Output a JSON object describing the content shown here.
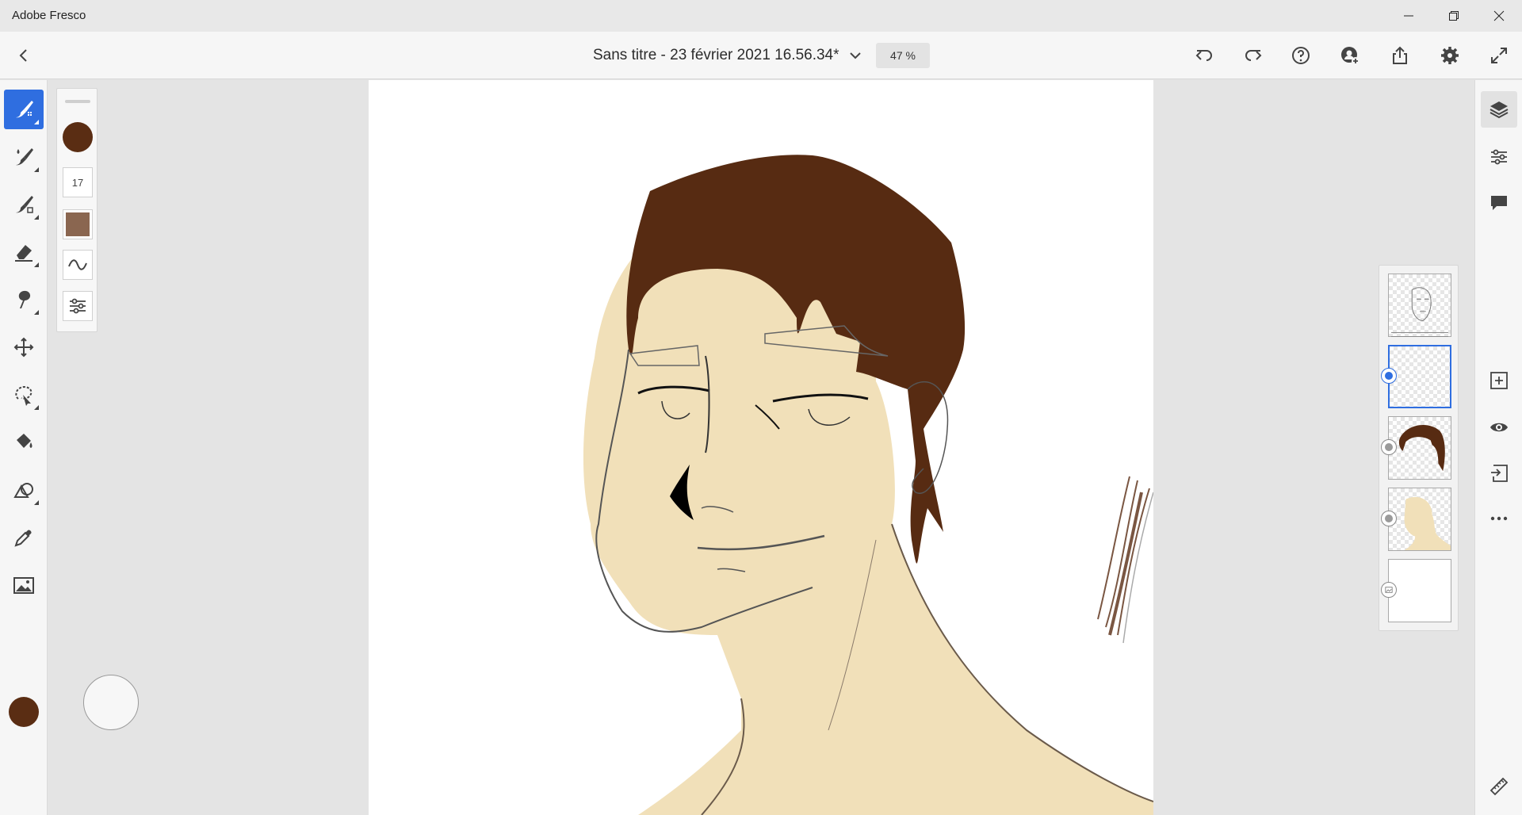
{
  "window": {
    "app_title": "Adobe Fresco",
    "minimize_icon": "minimize-icon",
    "restore_icon": "restore-icon",
    "close_icon": "close-icon"
  },
  "header": {
    "document_title": "Sans titre - 23 février 2021 16.56.34*",
    "zoom": "47 %",
    "actions": [
      "back-icon",
      "chevron-down-icon",
      "undo-icon",
      "redo-icon",
      "help-icon",
      "invite-icon",
      "share-icon",
      "settings-icon",
      "fullscreen-icon"
    ]
  },
  "left_toolbar": {
    "tools": [
      "pixel-brush",
      "live-brush",
      "vector-brush",
      "eraser",
      "smudge",
      "transform",
      "lasso-selection",
      "fill",
      "shapes",
      "eyedropper",
      "place-image"
    ],
    "active_tool": "pixel-brush",
    "current_color": "#5a2d13"
  },
  "brush_panel": {
    "color": "#5a2d13",
    "size": "17",
    "texture_color": "#8a6650",
    "buttons": [
      "brush-smoothing-icon",
      "brush-settings-icon"
    ]
  },
  "right_toolbar": {
    "top_buttons": [
      "layers-icon",
      "layer-properties-icon",
      "comments-icon"
    ],
    "layer_actions": [
      "add-layer-icon",
      "visibility-icon",
      "import-layer-icon",
      "more-icon"
    ],
    "bottom_button": "ruler-icon"
  },
  "layers": [
    {
      "name": "sketch",
      "type": "pixel",
      "selected": false
    },
    {
      "name": "empty",
      "type": "pixel",
      "selected": true
    },
    {
      "name": "hair",
      "type": "pixel",
      "selected": false
    },
    {
      "name": "skin",
      "type": "pixel",
      "selected": false
    },
    {
      "name": "background",
      "type": "image",
      "selected": false
    }
  ],
  "colors": {
    "accent": "#2f6ee0",
    "hair": "#5a2d13",
    "skin": "#f1e0b9"
  }
}
